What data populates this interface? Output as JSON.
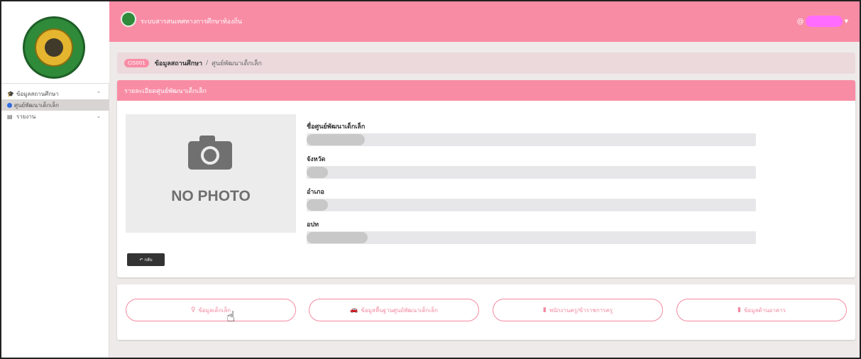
{
  "app": {
    "title": "ระบบสารสนเทศทางการศึกษาท้องถิ่น"
  },
  "sidebar": {
    "items": [
      {
        "icon": "graduation-cap-icon",
        "label": "ข้อมูลสถานศึกษา",
        "chevron": "up"
      },
      {
        "icon": "dot-icon",
        "label": "ศูนย์พัฒนาเด็กเล็ก",
        "active": true
      },
      {
        "icon": "document-icon",
        "label": "รายงาน",
        "chevron": "down"
      }
    ]
  },
  "breadcrumb": {
    "code": "CIS001",
    "main": "ข้อมูลสถานศึกษา",
    "separator": "/",
    "sub": "ศูนย์พัฒนาเด็กเล็ก"
  },
  "detail_card": {
    "header": "รายละเอียดศูนย์พัฒนาเด็กเล็ก",
    "photo_text": "NO PHOTO",
    "fields": [
      {
        "label": "ชื่อศูนย์พัฒนาเด็กเล็ก"
      },
      {
        "label": "จังหวัด"
      },
      {
        "label": "อำเภอ"
      },
      {
        "label": "อปท"
      }
    ],
    "back_button": "กลับ"
  },
  "actions": [
    {
      "label": "ข้อมูลเด็กเล็ก",
      "icon": "child-icon"
    },
    {
      "label": "ข้อมูลพื้นฐานศูนย์พัฒนาเด็กเล็ก",
      "icon": "car-icon"
    },
    {
      "label": "พนักงานครู/ข้าราชการครู",
      "icon": "bookmark-icon"
    },
    {
      "label": "ข้อมูลด้านอาคาร",
      "icon": "bookmark-icon"
    }
  ],
  "colors": {
    "accent": "#f98ca5",
    "breadcrumb_bg": "#ebd9dc",
    "page_bg": "#efeaea"
  }
}
